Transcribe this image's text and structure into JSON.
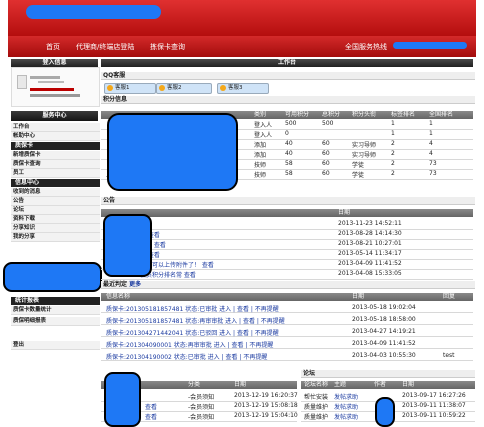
{
  "nav": {
    "home": "首页",
    "agent_login": "代理商/终端店登陆",
    "card_query": "拣保卡查询",
    "hotline_label": "全国服务热线"
  },
  "sidebar": {
    "login_header": "登入信息",
    "service_center": "服务中心",
    "sections": [
      {
        "title": "",
        "items": [
          "工作台",
          "帐助中心"
        ]
      },
      {
        "title": "质保卡",
        "items": [
          "新增质保卡",
          "质保卡查询",
          "员工"
        ]
      },
      {
        "title": "信息中心",
        "items": [
          "收到的消息",
          "公告",
          "论坛",
          "资料下载",
          "分享知识",
          "我的分享"
        ]
      }
    ],
    "stats_section": "统计报表",
    "stats_items": [
      "质保卡数量统计",
      "质保明细报表"
    ],
    "logout": "登出"
  },
  "workbench": {
    "header": "工作台",
    "qq_section": "QQ客服",
    "qq_tabs": [
      {
        "badge": "QQ交谈",
        "label": "客服1"
      },
      {
        "badge": "QQ交谈",
        "label": "客服2"
      },
      {
        "badge": "未启用",
        "label": "客服3"
      }
    ],
    "points_section": "积分信息",
    "points_headers": [
      "类别",
      "可用积分",
      "总积分",
      "积分头衔",
      "标签排名",
      "全国排名"
    ],
    "points_rows": [
      [
        "登入人",
        "500",
        "500",
        "",
        "1",
        "1"
      ],
      [
        "登入人",
        "0",
        "",
        "",
        "1",
        "1"
      ],
      [
        "添加",
        "40",
        "60",
        "实习导师",
        "2",
        "4"
      ],
      [
        "添加",
        "40",
        "60",
        "实习导师",
        "2",
        "4"
      ],
      [
        "技师",
        "58",
        "60",
        "学徒",
        "2",
        "73"
      ],
      [
        "技师",
        "58",
        "60",
        "学徒",
        "2",
        "73"
      ]
    ],
    "points_first_col": [
      "",
      "",
      "",
      "",
      "",
      "上周技师积分增加数"
    ],
    "notice_section": "公告",
    "notice_date_header": "日期",
    "notices": [
      {
        "title": "查看",
        "date": "2013-11-23 14:52:11"
      },
      {
        "title": "谷 查看",
        "date": "2013-08-28 14:14:30"
      },
      {
        "title": "通告 查看",
        "date": "2013-08-21 10:27:01"
      },
      {
        "title": "了 查看",
        "date": "2013-05-14 11:34:17"
      },
      {
        "title": "他们可以上传附件了！ 查看",
        "date": "2013-04-09 11:41:52"
      },
      {
        "title": "会员积分排名常 查看",
        "date": "2013-04-08 15:33:05"
      }
    ],
    "recent_section": "最近判定",
    "recent_more": "更多",
    "recent_headers": [
      "信息名称",
      "日期",
      "回复"
    ],
    "recent_rows": [
      {
        "title": "质保卡:201305181857481 状态:已审批 进入 | 查看 | 不再提醒",
        "date": "2013-05-18 19:02:04",
        "reply": ""
      },
      {
        "title": "质保卡:201305181857481 状态:再审审批 进入 | 查看 | 不再提醒",
        "date": "2013-05-18 18:58:00",
        "reply": ""
      },
      {
        "title": "质保卡:201304271442041 状态:已驳回 进入 | 查看 | 不再提醒",
        "date": "2013-04-27 14:19:21",
        "reply": ""
      },
      {
        "title": "质保卡:201304090001 状态:再审审批 进入 | 查看 | 不再提醒",
        "date": "2013-04-09 11:41:52",
        "reply": ""
      },
      {
        "title": "质保卡:201304190002 状态:已审批 进入 | 查看 | 不再提醒",
        "date": "2013-04-03 10:55:30",
        "reply": "test"
      }
    ],
    "bottom_left": {
      "headers": [
        "",
        "分类",
        "日期"
      ],
      "rows": [
        [
          "",
          "-会员须知",
          "2013-12-19 16:20:37"
        ],
        [
          "查看",
          "-会员须知",
          "2013-12-19 15:08:18"
        ],
        [
          "查看",
          "-会员须知",
          "2013-12-19 15:04:10"
        ]
      ]
    },
    "forum": {
      "section": "论坛",
      "headers": [
        "论坛名称",
        "主题",
        "作者",
        "日期"
      ],
      "rows": [
        [
          "帮忙安装",
          "发帖求助",
          "",
          "2013-09-17 16:27:26"
        ],
        [
          "质量维护",
          "发帖求助",
          "",
          "2013-09-11 11:38:07"
        ],
        [
          "质量维护",
          "发帖求助",
          "",
          "2013-09-11 10:59:22"
        ]
      ]
    }
  }
}
